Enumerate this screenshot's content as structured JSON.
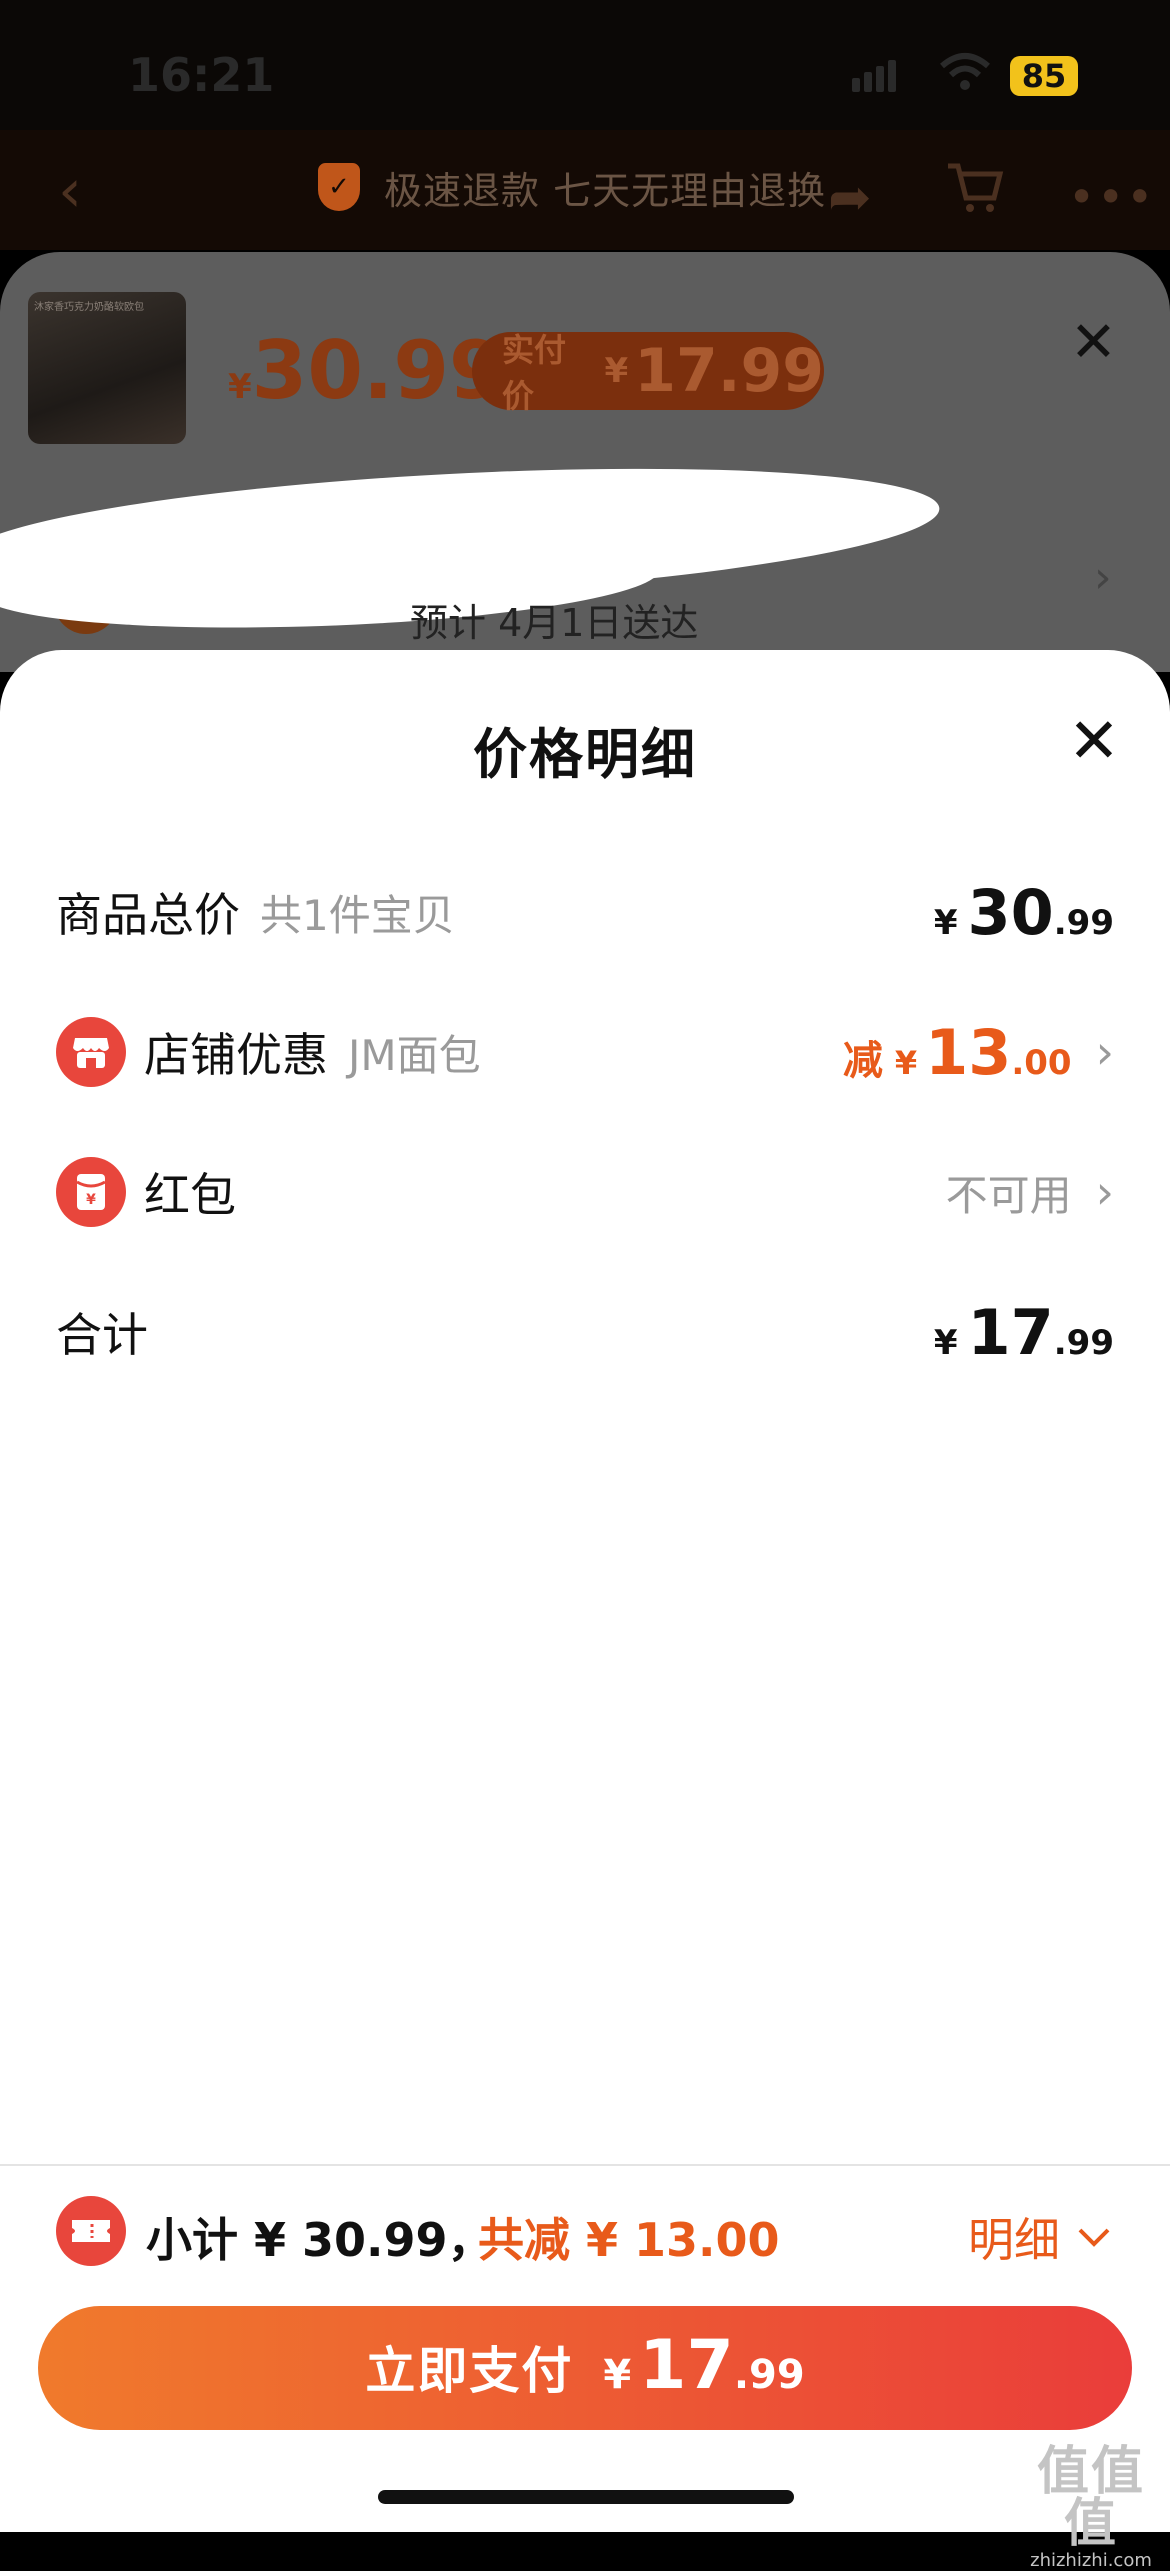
{
  "status_bar": {
    "time": "16:21",
    "battery": "85"
  },
  "nav": {
    "refund_text": "极速退款 七天无理由退换"
  },
  "product": {
    "currency": "¥",
    "price": "30.99",
    "pay_label": "实付价",
    "pay_price": "17.99",
    "thumb_caption": "沐家香巧克力奶酪软欧包",
    "delivery": "预计 4月1日送达"
  },
  "detail": {
    "title": "价格明细",
    "rows": [
      {
        "label": "商品总价",
        "sub": "共1件宝贝",
        "currency": "¥",
        "int": "30",
        "dec": ".99"
      },
      {
        "label": "店铺优惠",
        "sub": "JM面包",
        "prefix": "减",
        "currency": "¥",
        "int": "13",
        "dec": ".00"
      },
      {
        "label": "红包",
        "status": "不可用"
      },
      {
        "label": "合计",
        "currency": "¥",
        "int": "17",
        "dec": ".99"
      }
    ]
  },
  "bottom": {
    "subtotal": "小计 ¥ 30.99，",
    "saving": "共减 ¥ 13.00",
    "detail_link": "明细",
    "pay_label": "立即支付",
    "pay_currency": "¥",
    "pay_int": "17",
    "pay_dec": ".99"
  },
  "watermark": {
    "big": "值值值",
    "small": "zhizhizhi.com"
  },
  "colors": {
    "accent": "#e85a1a",
    "icon_red": "#e8463c",
    "button_start": "#f07a2c",
    "button_end": "#ea3d3a"
  }
}
